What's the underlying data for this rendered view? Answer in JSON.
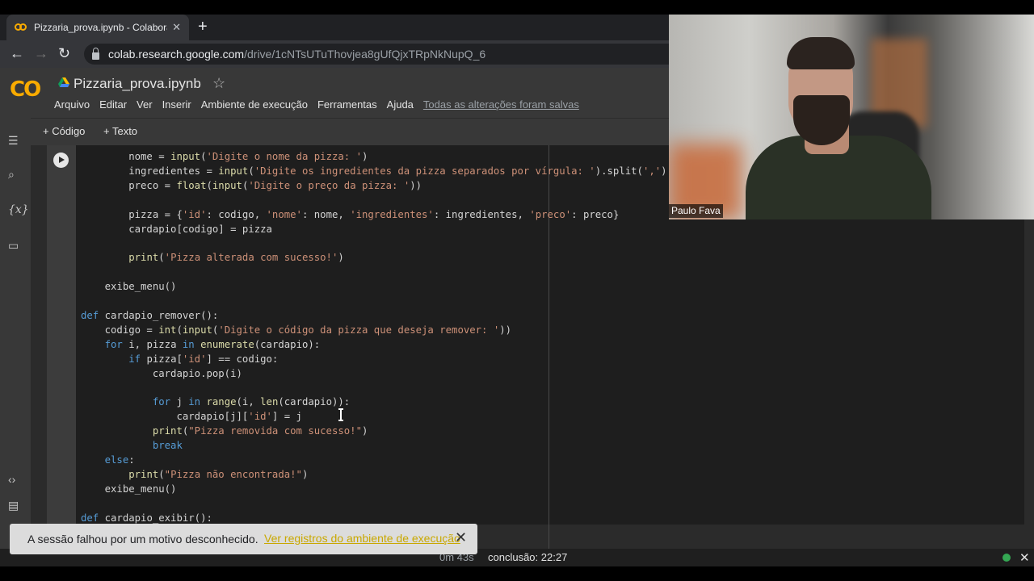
{
  "browser": {
    "tab_title": "Pizzaria_prova.ipynb - Colaborato",
    "new_tab": "+",
    "url_host": "colab.research.google.com",
    "url_path": "/drive/1cNTsUTuThovjea8gUfQjxTRpNkNupQ_6"
  },
  "colab": {
    "logo": "CO",
    "notebook_title": "Pizzaria_prova.ipynb",
    "menu": [
      "Arquivo",
      "Editar",
      "Ver",
      "Inserir",
      "Ambiente de execução",
      "Ferramentas",
      "Ajuda"
    ],
    "saved_status": "Todas as alterações foram salvas",
    "toolbar": {
      "add_code": "+ Código",
      "add_text": "+ Texto"
    }
  },
  "code_lines": [
    "        nome = input('Digite o nome da pizza: ')",
    "        ingredientes = input('Digite os ingredientes da pizza separados por vírgula: ').split(',')",
    "        preco = float(input('Digite o preço da pizza: '))",
    "",
    "        pizza = {'id': codigo, 'nome': nome, 'ingredientes': ingredientes, 'preco': preco}",
    "        cardapio[codigo] = pizza",
    "",
    "        print('Pizza alterada com sucesso!')",
    "",
    "    exibe_menu()",
    "",
    "def cardapio_remover():",
    "    codigo = int(input('Digite o código da pizza que deseja remover: '))",
    "    for i, pizza in enumerate(cardapio):",
    "        if pizza['id'] == codigo:",
    "            cardapio.pop(i)",
    "",
    "            for j in range(i, len(cardapio)):",
    "                cardapio[j]['id'] = j",
    "            print(\"Pizza removida com sucesso!\")",
    "            break",
    "    else:",
    "        print(\"Pizza não encontrada!\")",
    "    exibe_menu()",
    "",
    "def cardapio_exibir():"
  ],
  "snackbar": {
    "message": "A sessão falhou por um motivo desconhecido.",
    "link": "Ver registros do ambiente de execução",
    "close": "✕"
  },
  "statusbar": {
    "elapsed": "0m 43s",
    "completion": "conclusão: 22:27",
    "close": "✕"
  },
  "webcam": {
    "name": "Paulo Fava"
  },
  "colors": {
    "accent": "#f9ab00",
    "status_ok": "#34a853"
  }
}
